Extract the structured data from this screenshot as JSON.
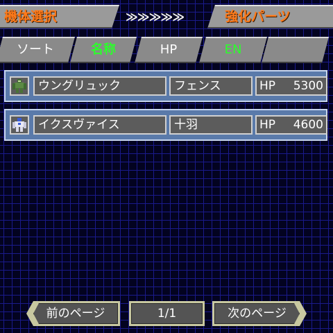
{
  "header": {
    "unit_select_label": "機体選択",
    "arrows": "≫≫≫≫≫",
    "parts_label": "強化パーツ"
  },
  "sort_bar": {
    "sort_label": "ソート",
    "buttons": [
      {
        "label": "名称",
        "color": "#2bff2b"
      },
      {
        "label": "HP",
        "color": "#ffffff"
      },
      {
        "label": "EN",
        "color": "#2bff2b"
      },
      {
        "label": "",
        "color": "#ffffff"
      }
    ]
  },
  "units": [
    {
      "name": "ウングリュック",
      "pilot": "フェンス",
      "stat_label": "HP",
      "stat_value": "5300",
      "icon": "green-mech-icon"
    },
    {
      "name": "イクスヴァイス",
      "pilot": "十羽",
      "stat_label": "HP",
      "stat_value": "4600",
      "icon": "white-mech-icon"
    }
  ],
  "pager": {
    "prev_label": "前のページ",
    "page": "1/1",
    "next_label": "次のページ"
  },
  "colors": {
    "background": "#030320",
    "grid": "#1a1a8c",
    "header_text": "#ff7a1a",
    "row_bg": "#5a7aaa"
  }
}
